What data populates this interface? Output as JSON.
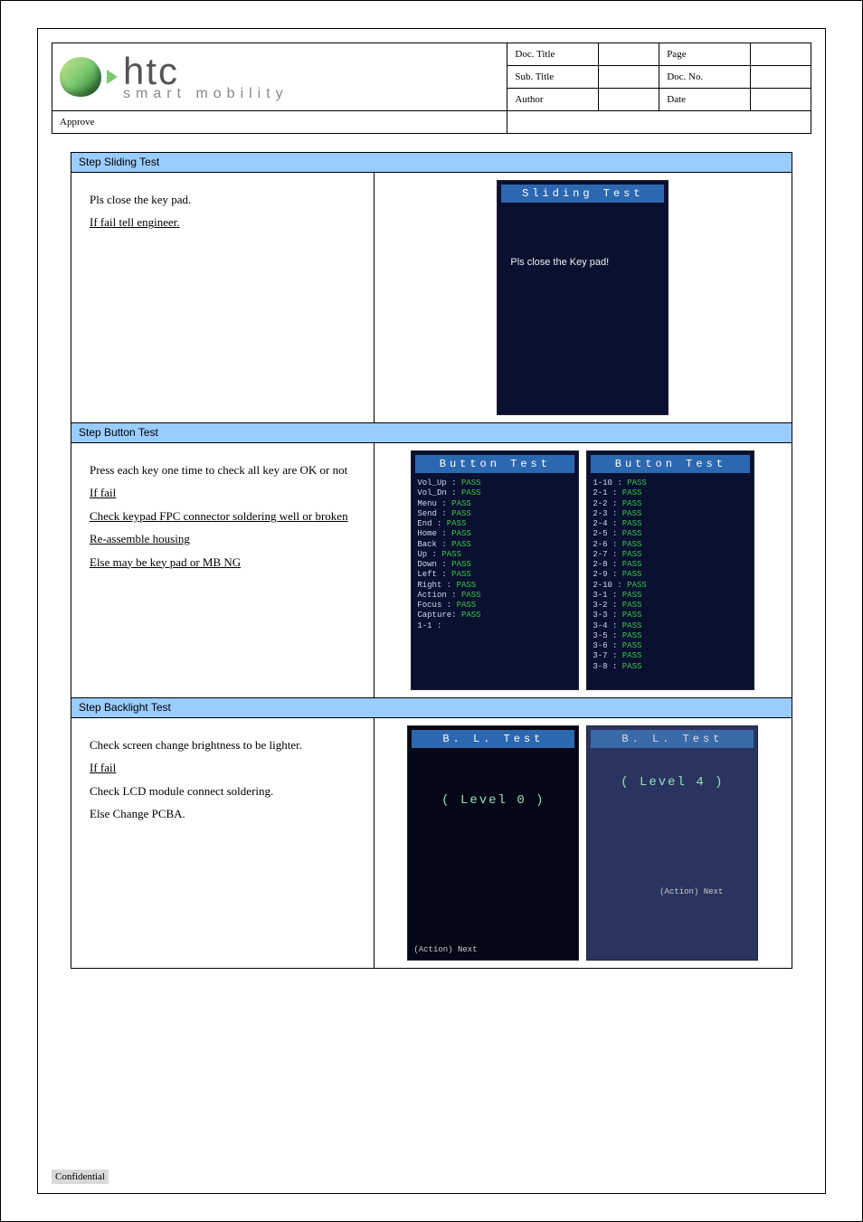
{
  "brand": {
    "name": "htc",
    "tagline": "smart mobility"
  },
  "header": {
    "doc_title_label": "Doc. Title",
    "doc_title": "",
    "page_label": "Page",
    "page_value": "",
    "sub_title_label": "Sub. Title",
    "sub_title": "",
    "doc_no_label": "Doc. No.",
    "doc_no": "",
    "author_label": "Author",
    "author": "",
    "approve_label": "Approve",
    "approve": "",
    "date_label": "Date",
    "date": ""
  },
  "confidential": "Confidential",
  "steps": [
    {
      "title": "Step Sliding Test",
      "instructions": {
        "intro": "Pls close the key pad.",
        "if_fail_label": "If fail tell engineer.",
        "fail_lines": []
      },
      "shots": [
        "sliding"
      ]
    },
    {
      "title": "Step Button Test",
      "instructions": {
        "intro": "Press each key one time to check all key are OK or not",
        "if_fail_label": "If fail",
        "fail_lines": [
          "Check keypad FPC connector soldering well or broken",
          "Re-assemble housing",
          "Else may be key pad or MB NG"
        ]
      },
      "shots": [
        "button1",
        "button2"
      ]
    },
    {
      "title": "Step Backlight Test",
      "instructions": {
        "intro": "Check screen change brightness to be lighter.",
        "if_fail_label": "If fail",
        "fail_lines": [
          "Check LCD module connect soldering.",
          "Else Change PCBA."
        ]
      },
      "shots": [
        "bl_dark",
        "bl_light"
      ]
    }
  ],
  "screens": {
    "sliding": {
      "bar": "Sliding  Test",
      "msg": "Pls close the Key pad!"
    },
    "button1": {
      "bar": "Button Test",
      "lines": [
        "Vol_Up : PASS",
        "Vol_Dn : PASS",
        "Menu   : PASS",
        "Send   : PASS",
        "End    : PASS",
        "Home   : PASS",
        "Back   : PASS",
        "Up     : PASS",
        "Down   : PASS",
        "Left   : PASS",
        "Right  : PASS",
        "Action : PASS",
        "Focus  : PASS",
        "Capture: PASS",
        "1-1    : "
      ]
    },
    "button2": {
      "bar": "Button Test",
      "lines": [
        "1-10   : PASS",
        "2-1    : PASS",
        "2-2    : PASS",
        "2-3    : PASS",
        "2-4    : PASS",
        "2-5    : PASS",
        "2-6    : PASS",
        "2-7    : PASS",
        "2-8    : PASS",
        "2-9    : PASS",
        "2-10   : PASS",
        "3-1    : PASS",
        "3-2    : PASS",
        "3-3    : PASS",
        "3-4    : PASS",
        "3-5    : PASS",
        "3-6    : PASS",
        "3-7    : PASS",
        "3-8    : PASS"
      ]
    },
    "bl_dark": {
      "bar": "B. L.  Test",
      "level": "( Level 0 )",
      "footer": "(Action) Next"
    },
    "bl_light": {
      "bar": "B. L.  Test",
      "level": "( Level 4 )",
      "footer": "(Action) Next"
    }
  }
}
